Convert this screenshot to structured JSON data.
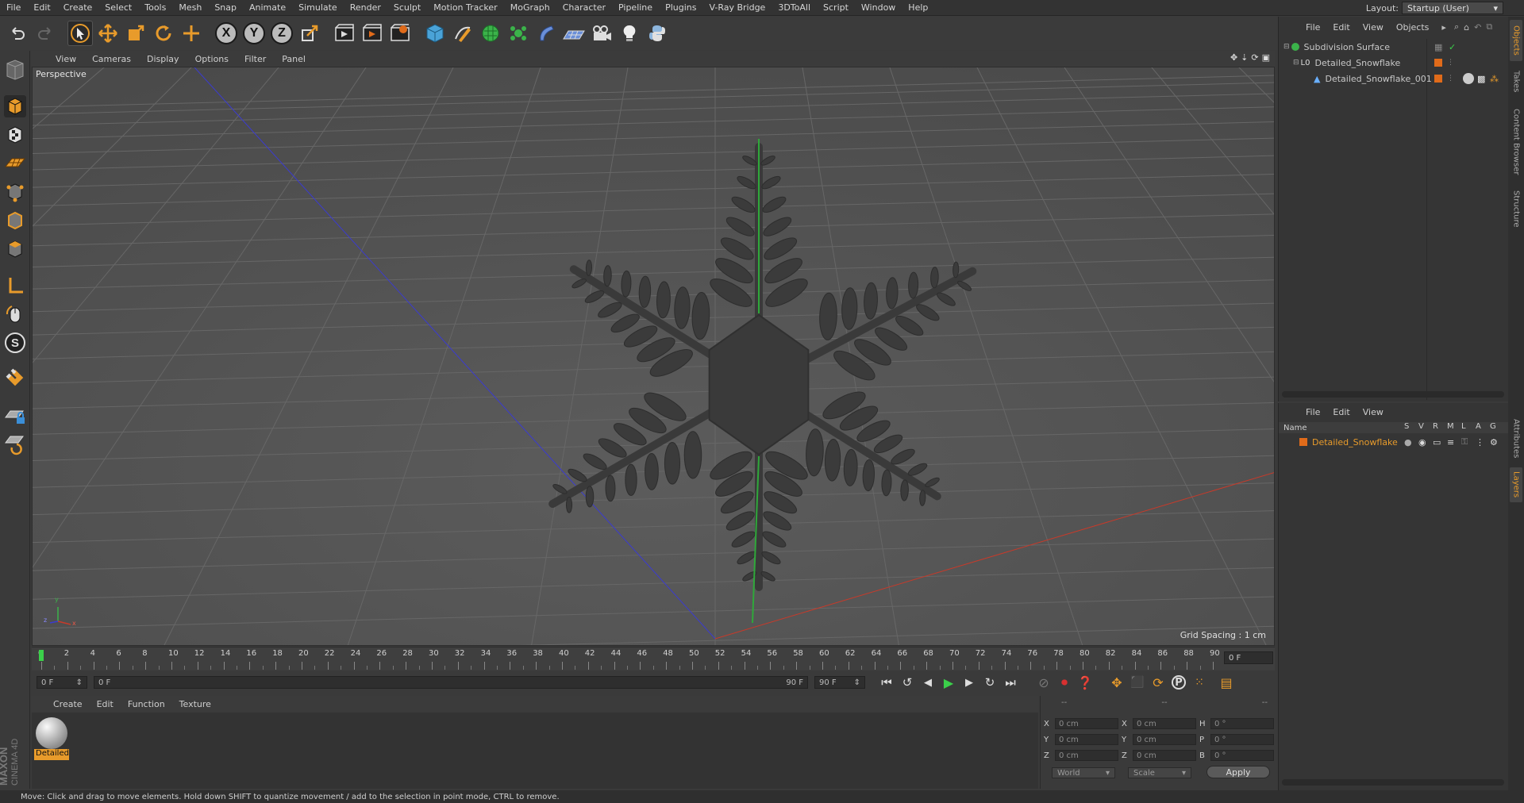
{
  "menubar": {
    "items": [
      "File",
      "Edit",
      "Create",
      "Select",
      "Tools",
      "Mesh",
      "Snap",
      "Animate",
      "Simulate",
      "Render",
      "Sculpt",
      "Motion Tracker",
      "MoGraph",
      "Character",
      "Pipeline",
      "Plugins",
      "V-Ray Bridge",
      "3DToAll",
      "Script",
      "Window",
      "Help"
    ],
    "layout_label": "Layout:",
    "layout_value": "Startup (User)"
  },
  "toolbar": {
    "axis_x": "X",
    "axis_y": "Y",
    "axis_z": "Z",
    "icons": [
      "undo-icon",
      "redo-icon",
      "select-arrow-icon",
      "move-icon",
      "scale-icon",
      "rotate-icon",
      "live-selection-icon",
      "axis-x-icon",
      "axis-y-icon",
      "axis-z-icon",
      "coordinate-system-icon",
      "render-view-icon",
      "render-picture-viewer-icon",
      "edit-render-settings-icon",
      "cube-primitive-icon",
      "pen-spline-icon",
      "subdivision-surface-icon",
      "cloner-icon",
      "deformer-icon",
      "floor-icon",
      "camera-icon",
      "light-icon",
      "python-icon"
    ]
  },
  "viewport": {
    "menu": [
      "View",
      "Cameras",
      "Display",
      "Options",
      "Filter",
      "Panel"
    ],
    "label": "Perspective",
    "grid_spacing": "Grid Spacing : 1 cm",
    "axis_gizmo": {
      "y": "y",
      "z": "z",
      "x": "x"
    }
  },
  "timeline": {
    "ticks": [
      "0",
      "2",
      "4",
      "6",
      "8",
      "10",
      "12",
      "14",
      "16",
      "18",
      "20",
      "22",
      "24",
      "26",
      "28",
      "30",
      "32",
      "34",
      "36",
      "38",
      "40",
      "42",
      "44",
      "46",
      "48",
      "50",
      "52",
      "54",
      "56",
      "58",
      "60",
      "62",
      "64",
      "66",
      "68",
      "70",
      "72",
      "74",
      "76",
      "78",
      "80",
      "82",
      "84",
      "86",
      "88",
      "90"
    ],
    "current_frame_field": "0 F"
  },
  "transport": {
    "start_field": "0 F",
    "range_start": "0 F",
    "range_end": "90 F",
    "end_field": "90 F"
  },
  "material_manager": {
    "menu": [
      "Create",
      "Edit",
      "Function",
      "Texture"
    ],
    "material_name": "Detailed"
  },
  "coordinates": {
    "header_dashes": [
      "--",
      "--",
      "--"
    ],
    "rows": [
      {
        "l1": "X",
        "v1": "0 cm",
        "l2": "X",
        "v2": "0 cm",
        "l3": "H",
        "v3": "0 °"
      },
      {
        "l1": "Y",
        "v1": "0 cm",
        "l2": "Y",
        "v2": "0 cm",
        "l3": "P",
        "v3": "0 °"
      },
      {
        "l1": "Z",
        "v1": "0 cm",
        "l2": "Z",
        "v2": "0 cm",
        "l3": "B",
        "v3": "0 °"
      }
    ],
    "mode_world": "World",
    "mode_scale": "Scale",
    "apply_label": "Apply"
  },
  "object_manager": {
    "menu": [
      "File",
      "Edit",
      "View",
      "Objects"
    ],
    "objects": [
      {
        "name": "Subdivision Surface",
        "indent": 0
      },
      {
        "name": "Detailed_Snowflake",
        "indent": 1
      },
      {
        "name": "Detailed_Snowflake_001",
        "indent": 2
      }
    ]
  },
  "layer_manager": {
    "menu": [
      "File",
      "Edit",
      "View"
    ],
    "columns": {
      "name": "Name",
      "s": "S",
      "v": "V",
      "r": "R",
      "m": "M",
      "l": "L",
      "a": "A",
      "g": "G"
    },
    "layer_name": "Detailed_Snowflake"
  },
  "vertical_tabs": [
    "Objects",
    "Takes",
    "Content Browser",
    "Structure",
    "Attributes",
    "Layers"
  ],
  "status_text": "Move: Click and drag to move elements. Hold down SHIFT to quantize movement / add to the selection in point mode, CTRL to remove.",
  "colors": {
    "accent": "#e89b2b",
    "object_tag": "#e06b1a",
    "grid_bg": "#545454"
  },
  "branding": {
    "maxon": "MAXON",
    "product": "CINEMA 4D"
  }
}
